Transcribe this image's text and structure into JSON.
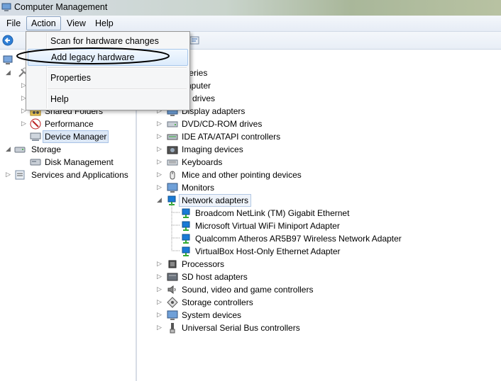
{
  "window": {
    "title": "Computer Management"
  },
  "menubar": {
    "file": "File",
    "action": "Action",
    "view": "View",
    "help": "Help"
  },
  "context_menu": {
    "items": [
      "Scan for hardware changes",
      "Add legacy hardware",
      "Properties",
      "Help"
    ],
    "highlighted": "Add legacy hardware"
  },
  "left_tree": {
    "items": [
      "Shared Folders",
      "Performance",
      "Device Manager",
      "Storage",
      "Disk Management",
      "Services and Applications"
    ]
  },
  "right_tree": {
    "top_partial": [
      "atteries",
      "omputer",
      "isk drives"
    ],
    "categories": [
      "Display adapters",
      "DVD/CD-ROM drives",
      "IDE ATA/ATAPI controllers",
      "Imaging devices",
      "Keyboards",
      "Mice and other pointing devices",
      "Monitors",
      "Network adapters"
    ],
    "network_adapters": [
      "Broadcom NetLink (TM) Gigabit Ethernet",
      "Microsoft Virtual WiFi Miniport Adapter",
      "Qualcomm Atheros AR5B97 Wireless Network Adapter",
      "VirtualBox Host-Only Ethernet Adapter"
    ],
    "categories_after": [
      "Processors",
      "SD host adapters",
      "Sound, video and game controllers",
      "Storage controllers",
      "System devices",
      "Universal Serial Bus controllers"
    ]
  },
  "colors": {
    "highlight_ellipse": "#000000",
    "selection": "#dde8f6",
    "network_icon": "#1a7bd6"
  }
}
